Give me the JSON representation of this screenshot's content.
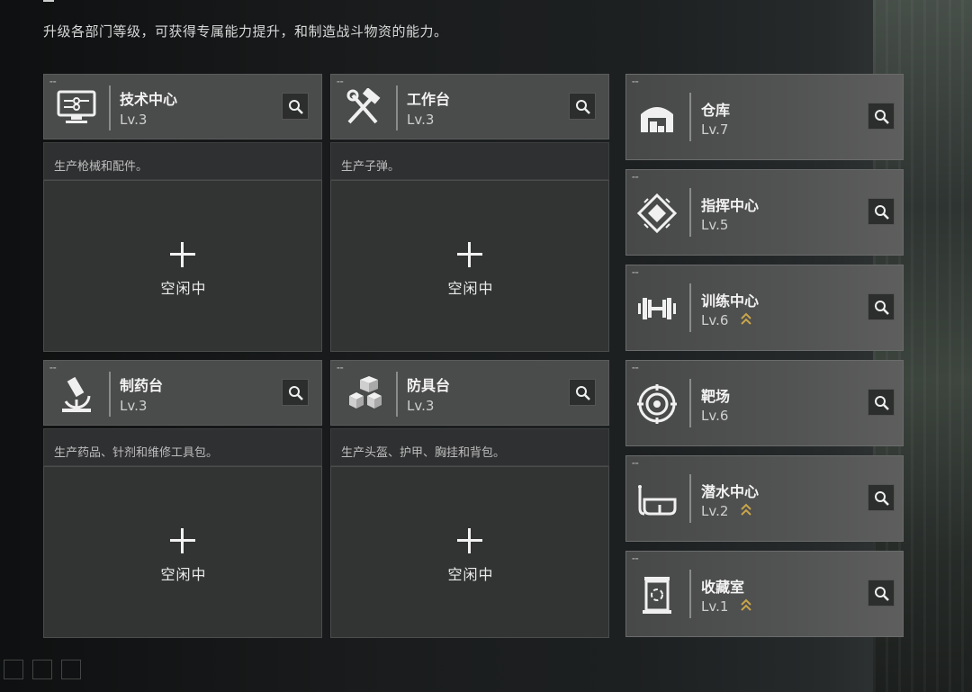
{
  "header": {
    "subtitle": "升级各部门等级，可获得专属能力提升，和制造战斗物资的能力。"
  },
  "production": [
    {
      "name": "技术中心",
      "level": "Lv.3",
      "desc": "生产枪械和配件。",
      "status": "空闲中",
      "icon": "computer-monitor-icon"
    },
    {
      "name": "工作台",
      "level": "Lv.3",
      "desc": "生产子弹。",
      "status": "空闲中",
      "icon": "hammer-wrench-icon"
    },
    {
      "name": "制药台",
      "level": "Lv.3",
      "desc": "生产药品、针剂和维修工具包。",
      "status": "空闲中",
      "icon": "microscope-icon"
    },
    {
      "name": "防具台",
      "level": "Lv.3",
      "desc": "生产头盔、护甲、胸挂和背包。",
      "status": "空闲中",
      "icon": "cubes-icon"
    }
  ],
  "facilities": [
    {
      "name": "仓库",
      "level": "Lv.7",
      "upgradable": false,
      "icon": "warehouse-icon"
    },
    {
      "name": "指挥中心",
      "level": "Lv.5",
      "upgradable": false,
      "icon": "chip-icon"
    },
    {
      "name": "训练中心",
      "level": "Lv.6",
      "upgradable": true,
      "icon": "dumbbell-icon"
    },
    {
      "name": "靶场",
      "level": "Lv.6",
      "upgradable": false,
      "icon": "target-icon"
    },
    {
      "name": "潜水中心",
      "level": "Lv.2",
      "upgradable": true,
      "icon": "diving-mask-icon"
    },
    {
      "name": "收藏室",
      "level": "Lv.1",
      "upgradable": true,
      "icon": "display-case-icon"
    }
  ],
  "colors": {
    "upgrade_chevron": "#c9a64a",
    "card_bg": "#4a4b4b",
    "body_bg": "#323333"
  }
}
